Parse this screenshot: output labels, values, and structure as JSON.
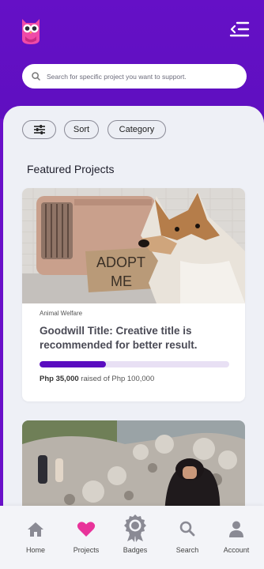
{
  "search": {
    "placeholder": "Search for specific project you want to support."
  },
  "filters": {
    "sort_label": "Sort",
    "category_label": "Category"
  },
  "section": {
    "title": "Featured Projects"
  },
  "card": {
    "image_sign": "ADOPT ME",
    "category": "Animal Welfare",
    "title": "Goodwill Title: Creative title is recommended for better result.",
    "raised_amount": "Php 35,000",
    "raised_suffix": "raised of Php 100,000",
    "progress_fraction": 0.35
  },
  "nav": [
    {
      "label": "Home"
    },
    {
      "label": "Projects"
    },
    {
      "label": "Badges"
    },
    {
      "label": "Search"
    },
    {
      "label": "Account"
    }
  ],
  "colors": {
    "brand": "#6510c6",
    "accent_pink": "#e8339a",
    "progress": "#5a0cc0"
  }
}
